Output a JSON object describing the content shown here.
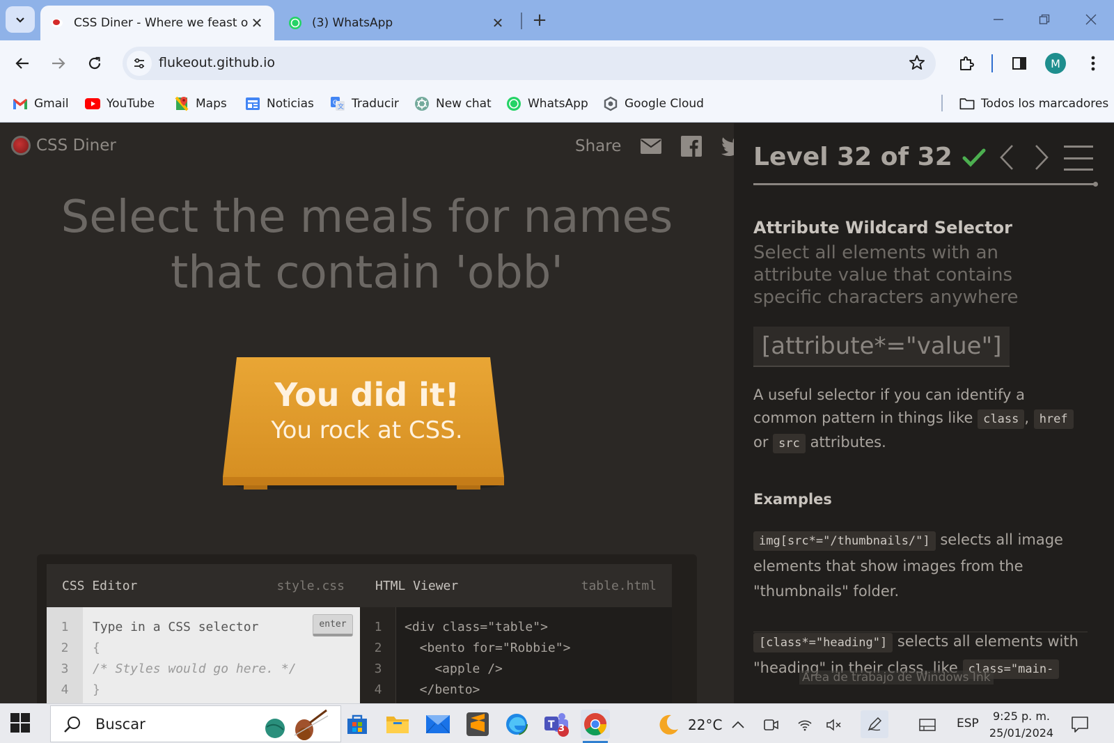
{
  "browser": {
    "tabs": [
      {
        "title": "CSS Diner - Where we feast on CSS Selectors!",
        "active": true
      },
      {
        "title": "(3) WhatsApp",
        "active": false
      }
    ],
    "url": "flukeout.github.io",
    "profile_initial": "M",
    "bookmarks": [
      "Gmail",
      "YouTube",
      "Maps",
      "Noticias",
      "Traducir",
      "New chat",
      "WhatsApp",
      "Google Cloud"
    ],
    "all_bookmarks_label": "Todos los marcadores"
  },
  "header": {
    "logo_text": "CSS Diner",
    "share_label": "Share"
  },
  "instruction": "Select the meals for names that contain 'obb'",
  "table_message": {
    "line1": "You did it!",
    "line2": "You rock at CSS."
  },
  "css_editor": {
    "title": "CSS Editor",
    "filename": "style.css",
    "placeholder": "Type in a CSS selector",
    "enter_label": "enter",
    "lines": [
      "1",
      "2",
      "3",
      "4"
    ],
    "code": [
      "{",
      "/* Styles would go here. */",
      "}"
    ]
  },
  "html_viewer": {
    "title": "HTML Viewer",
    "filename": "table.html",
    "lines": [
      "1",
      "2",
      "3",
      "4"
    ],
    "code": [
      "<div class=\"table\">",
      "  <bento for=\"Robbie\">",
      "    <apple />",
      "  </bento>"
    ]
  },
  "sidebar": {
    "level": "Level 32 of 32",
    "progress_fraction": 1.0,
    "selector_name": "Attribute Wildcard Selector",
    "selector_title": "Select all elements with an attribute value that contains specific characters anywhere",
    "syntax": "[attribute*=\"value\"]",
    "hint_before": "A useful selector if you can identify a common pattern in things like",
    "hint_code1": "class",
    "hint_sep": ",",
    "hint_code2": "href",
    "hint_or": "or",
    "hint_code3": "src",
    "hint_after": "attributes.",
    "examples_heading": "Examples",
    "example1_code": "img[src*=\"/thumbnails/\"]",
    "example1_text": "selects all image elements that show images from the \"thumbnails\" folder.",
    "example2_code": "[class*=\"heading\"]",
    "example2_text": "selects all elements with \"heading\" in their class, like",
    "example2_code2": "class=\"main-",
    "overlay_text": "Área de trabajo de Windows Ink"
  },
  "taskbar": {
    "search_placeholder": "Buscar",
    "temperature": "22°C",
    "language": "ESP",
    "time": "9:25 p. m.",
    "date": "25/01/2024",
    "teams_badge": "3"
  },
  "colors": {
    "accent_green": "#4caf50",
    "table_orange": "#e09a2c",
    "chrome_blue": "#8fb2e8"
  }
}
